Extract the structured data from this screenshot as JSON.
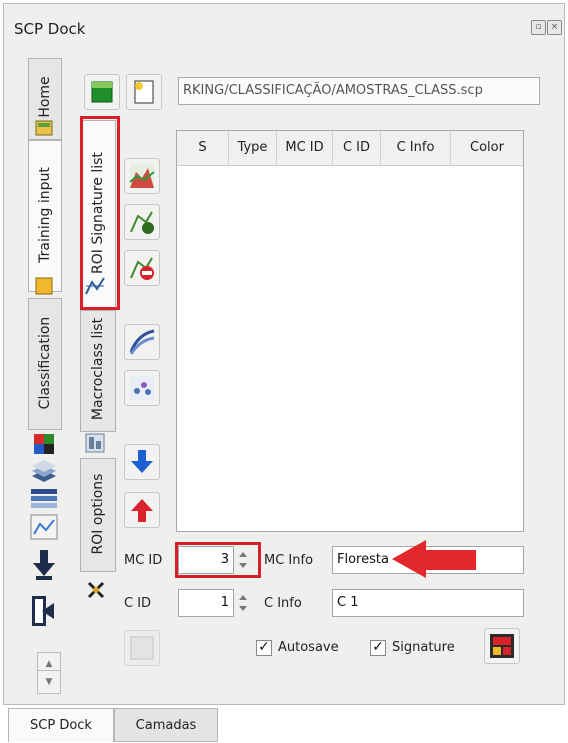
{
  "dock": {
    "title": "SCP Dock",
    "title_buttons": [
      "float-icon",
      "close-icon"
    ]
  },
  "side_tabs": [
    "Home",
    "Training input",
    "Classification"
  ],
  "inner_tabs": [
    "ROI Signature list",
    "Macroclass list",
    "ROI options"
  ],
  "path_field": {
    "value": "RKING/CLASSIFICAÇÃO/AMOSTRAS_CLASS.scp"
  },
  "table": {
    "headers": [
      "S",
      "Type",
      "MC ID",
      "C ID",
      "C Info",
      "Color"
    ]
  },
  "form": {
    "mc_id_label": "MC ID",
    "mc_id_value": "3",
    "mc_info_label": "MC Info",
    "mc_info_value": "Floresta",
    "c_id_label": "C ID",
    "c_id_value": "1",
    "c_info_label": "C Info",
    "c_info_value": "C 1"
  },
  "options": {
    "autosave_label": "Autosave",
    "autosave_checked": true,
    "signature_label": "Signature",
    "signature_checked": true,
    "check_mark": "✓"
  },
  "bottom_tabs": [
    "SCP Dock",
    "Camadas"
  ],
  "colors": {
    "highlight": "#d8202a",
    "arrow": "#e3282d"
  }
}
